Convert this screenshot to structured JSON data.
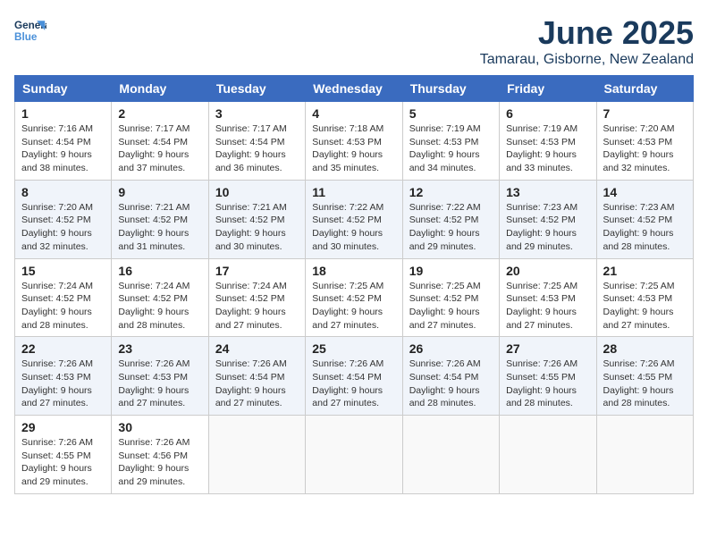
{
  "header": {
    "logo_line1": "General",
    "logo_line2": "Blue",
    "month": "June 2025",
    "location": "Tamarau, Gisborne, New Zealand"
  },
  "days_of_week": [
    "Sunday",
    "Monday",
    "Tuesday",
    "Wednesday",
    "Thursday",
    "Friday",
    "Saturday"
  ],
  "weeks": [
    [
      {
        "day": "1",
        "sunrise": "7:16 AM",
        "sunset": "4:54 PM",
        "daylight": "9 hours and 38 minutes."
      },
      {
        "day": "2",
        "sunrise": "7:17 AM",
        "sunset": "4:54 PM",
        "daylight": "9 hours and 37 minutes."
      },
      {
        "day": "3",
        "sunrise": "7:17 AM",
        "sunset": "4:54 PM",
        "daylight": "9 hours and 36 minutes."
      },
      {
        "day": "4",
        "sunrise": "7:18 AM",
        "sunset": "4:53 PM",
        "daylight": "9 hours and 35 minutes."
      },
      {
        "day": "5",
        "sunrise": "7:19 AM",
        "sunset": "4:53 PM",
        "daylight": "9 hours and 34 minutes."
      },
      {
        "day": "6",
        "sunrise": "7:19 AM",
        "sunset": "4:53 PM",
        "daylight": "9 hours and 33 minutes."
      },
      {
        "day": "7",
        "sunrise": "7:20 AM",
        "sunset": "4:53 PM",
        "daylight": "9 hours and 32 minutes."
      }
    ],
    [
      {
        "day": "8",
        "sunrise": "7:20 AM",
        "sunset": "4:52 PM",
        "daylight": "9 hours and 32 minutes."
      },
      {
        "day": "9",
        "sunrise": "7:21 AM",
        "sunset": "4:52 PM",
        "daylight": "9 hours and 31 minutes."
      },
      {
        "day": "10",
        "sunrise": "7:21 AM",
        "sunset": "4:52 PM",
        "daylight": "9 hours and 30 minutes."
      },
      {
        "day": "11",
        "sunrise": "7:22 AM",
        "sunset": "4:52 PM",
        "daylight": "9 hours and 30 minutes."
      },
      {
        "day": "12",
        "sunrise": "7:22 AM",
        "sunset": "4:52 PM",
        "daylight": "9 hours and 29 minutes."
      },
      {
        "day": "13",
        "sunrise": "7:23 AM",
        "sunset": "4:52 PM",
        "daylight": "9 hours and 29 minutes."
      },
      {
        "day": "14",
        "sunrise": "7:23 AM",
        "sunset": "4:52 PM",
        "daylight": "9 hours and 28 minutes."
      }
    ],
    [
      {
        "day": "15",
        "sunrise": "7:24 AM",
        "sunset": "4:52 PM",
        "daylight": "9 hours and 28 minutes."
      },
      {
        "day": "16",
        "sunrise": "7:24 AM",
        "sunset": "4:52 PM",
        "daylight": "9 hours and 28 minutes."
      },
      {
        "day": "17",
        "sunrise": "7:24 AM",
        "sunset": "4:52 PM",
        "daylight": "9 hours and 27 minutes."
      },
      {
        "day": "18",
        "sunrise": "7:25 AM",
        "sunset": "4:52 PM",
        "daylight": "9 hours and 27 minutes."
      },
      {
        "day": "19",
        "sunrise": "7:25 AM",
        "sunset": "4:52 PM",
        "daylight": "9 hours and 27 minutes."
      },
      {
        "day": "20",
        "sunrise": "7:25 AM",
        "sunset": "4:53 PM",
        "daylight": "9 hours and 27 minutes."
      },
      {
        "day": "21",
        "sunrise": "7:25 AM",
        "sunset": "4:53 PM",
        "daylight": "9 hours and 27 minutes."
      }
    ],
    [
      {
        "day": "22",
        "sunrise": "7:26 AM",
        "sunset": "4:53 PM",
        "daylight": "9 hours and 27 minutes."
      },
      {
        "day": "23",
        "sunrise": "7:26 AM",
        "sunset": "4:53 PM",
        "daylight": "9 hours and 27 minutes."
      },
      {
        "day": "24",
        "sunrise": "7:26 AM",
        "sunset": "4:54 PM",
        "daylight": "9 hours and 27 minutes."
      },
      {
        "day": "25",
        "sunrise": "7:26 AM",
        "sunset": "4:54 PM",
        "daylight": "9 hours and 27 minutes."
      },
      {
        "day": "26",
        "sunrise": "7:26 AM",
        "sunset": "4:54 PM",
        "daylight": "9 hours and 28 minutes."
      },
      {
        "day": "27",
        "sunrise": "7:26 AM",
        "sunset": "4:55 PM",
        "daylight": "9 hours and 28 minutes."
      },
      {
        "day": "28",
        "sunrise": "7:26 AM",
        "sunset": "4:55 PM",
        "daylight": "9 hours and 28 minutes."
      }
    ],
    [
      {
        "day": "29",
        "sunrise": "7:26 AM",
        "sunset": "4:55 PM",
        "daylight": "9 hours and 29 minutes."
      },
      {
        "day": "30",
        "sunrise": "7:26 AM",
        "sunset": "4:56 PM",
        "daylight": "9 hours and 29 minutes."
      },
      null,
      null,
      null,
      null,
      null
    ]
  ],
  "labels": {
    "sunrise": "Sunrise:",
    "sunset": "Sunset:",
    "daylight": "Daylight:"
  }
}
